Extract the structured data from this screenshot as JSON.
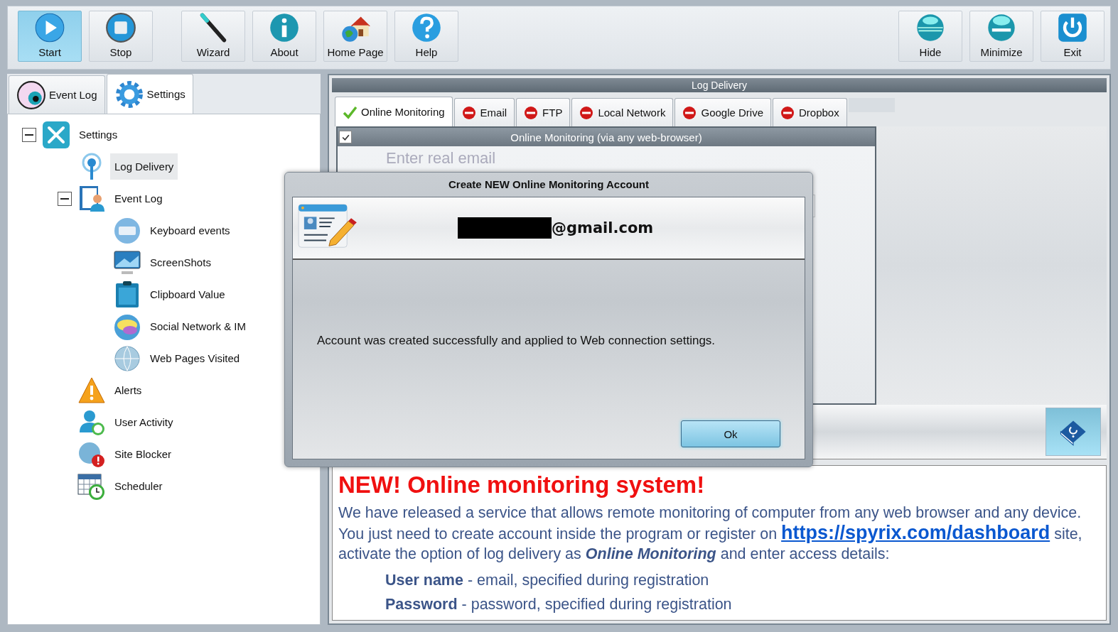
{
  "toolbar": {
    "left_buttons": [
      {
        "label": "Start",
        "selected": true
      },
      {
        "label": "Stop",
        "selected": false
      },
      {
        "label": "Wizard",
        "selected": false
      },
      {
        "label": "About",
        "selected": false
      },
      {
        "label": "Home Page",
        "selected": false
      },
      {
        "label": "Help",
        "selected": false
      }
    ],
    "right_buttons": [
      {
        "label": "Hide"
      },
      {
        "label": "Minimize"
      },
      {
        "label": "Exit"
      }
    ]
  },
  "side_tabs": [
    {
      "label": "Event Log",
      "selected": false
    },
    {
      "label": "Settings",
      "selected": true
    }
  ],
  "tree": {
    "label": "Settings",
    "expanded": true,
    "selected": false,
    "children": [
      {
        "label": "Log Delivery",
        "selected": true
      },
      {
        "label": "Event Log",
        "expanded": true,
        "selected": false,
        "children": [
          {
            "label": "Keyboard events",
            "selected": false
          },
          {
            "label": "ScreenShots",
            "selected": false
          },
          {
            "label": "Clipboard Value",
            "selected": false
          },
          {
            "label": "Social Network & IM",
            "selected": false
          },
          {
            "label": "Web Pages Visited",
            "selected": false
          }
        ]
      },
      {
        "label": "Alerts",
        "selected": false
      },
      {
        "label": "User Activity",
        "selected": false
      },
      {
        "label": "Site Blocker",
        "selected": false
      },
      {
        "label": "Scheduler",
        "selected": false
      }
    ]
  },
  "log_delivery": {
    "title": "Log Delivery",
    "tabs": [
      {
        "label": "Online Monitoring",
        "selected": true,
        "enabled": true
      },
      {
        "label": "Email",
        "selected": false,
        "enabled": false
      },
      {
        "label": "FTP",
        "selected": false,
        "enabled": false
      },
      {
        "label": "Local Network",
        "selected": false,
        "enabled": false
      },
      {
        "label": "Google Drive",
        "selected": false,
        "enabled": false
      },
      {
        "label": "Dropbox",
        "selected": false,
        "enabled": false
      }
    ],
    "section": {
      "title": "Online Monitoring (via any web-browser)",
      "checked": true,
      "email_field": {
        "placeholder": "Enter real email"
      }
    }
  },
  "dialog": {
    "title": "Create NEW Online Monitoring Account",
    "email": "@gmail.com",
    "message": "Account was created successfully and applied to Web connection settings.",
    "buttons": [
      "Ok"
    ]
  },
  "info": {
    "heading": "NEW! Online monitoring system!",
    "paragraph_before_link": "We have released a service that allows remote monitoring of computer from any web browser and any device. You just need to create account inside the program or register on",
    "link": "https://spyrix.com/dashboard",
    "paragraph_after_link": "site, activate the option of log delivery as *Online Monitoring* and enter access details:",
    "credentials": [
      "**User name** - email, specified during registration",
      "**Password** - password, specified during registration"
    ]
  }
}
